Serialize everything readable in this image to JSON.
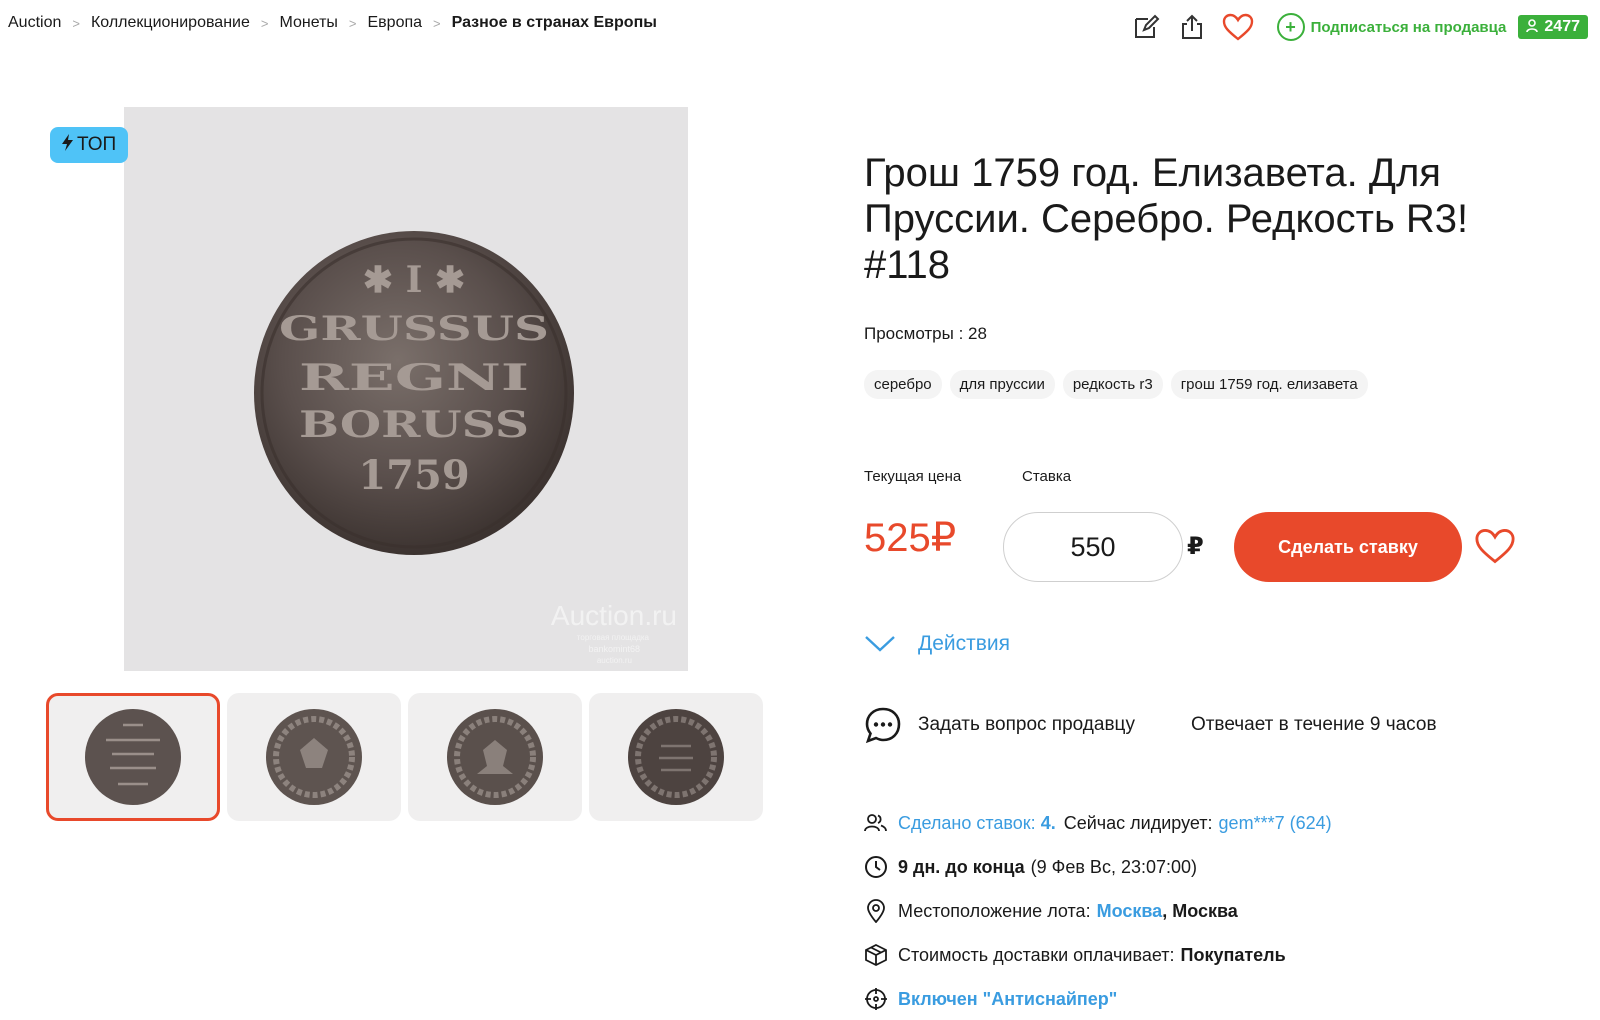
{
  "breadcrumb": [
    {
      "label": "Auction"
    },
    {
      "label": "Коллекционирование"
    },
    {
      "label": "Монеты"
    },
    {
      "label": "Европа"
    },
    {
      "label": "Разное в странах Европы"
    }
  ],
  "breadcrumb_separator": ">",
  "top_actions": {
    "subscribe_label": "Подписаться на продавца",
    "subscribe_symbol": "+",
    "seller_rating": "2477"
  },
  "badge": {
    "label": "ТОП"
  },
  "watermark": {
    "site": "Auction.ru",
    "line2": "торговая площадка",
    "line3": "bankomint68",
    "line4": "auction.ru"
  },
  "thumbnails": [
    {
      "icon": "coin-reverse-thumb-icon",
      "active": true
    },
    {
      "icon": "coin-obverse-thumb-icon",
      "active": false
    },
    {
      "icon": "coin-obverse2-thumb-icon",
      "active": false
    },
    {
      "icon": "coin-reverse2-thumb-icon",
      "active": false
    }
  ],
  "coin_inscription": {
    "line1": "✱ I ✱",
    "line2": "GRUSSUS",
    "line3": "REGNI",
    "line4": "BORUSS",
    "line5": "1759"
  },
  "lot": {
    "title": "Грош 1759 год. Елизавета. Для Пруссии. Серебро. Редкость R3! #118",
    "views": "Просмотры : 28",
    "tags": [
      "серебро",
      "для пруссии",
      "редкость r3",
      "грош 1759 год. елизавета"
    ]
  },
  "bidding": {
    "current_price_label": "Текущая цена",
    "bid_label": "Ставка",
    "current_price": "525₽",
    "bid_value": "550",
    "currency": "₽",
    "bid_button": "Сделать ставку"
  },
  "actions_label": "Действия",
  "ask": {
    "label": "Задать вопрос продавцу",
    "response_time": "Отвечает в течение 9 часов"
  },
  "info": {
    "bids_label": "Сделано ставок:",
    "bids_count": "4.",
    "leader_label": "Сейчас лидирует:",
    "leader": "gem***7 (624)",
    "time_left": "9 дн. до конца",
    "end_date": "(9 Фев Вс, 23:07:00)",
    "location_label": "Местоположение лота:",
    "location_city": "Москва",
    "location_region": ", Москва",
    "shipping_label": "Стоимость доставки оплачивает:",
    "shipping_payer": "Покупатель",
    "antisniper": "Включен \"Антиснайпер\""
  },
  "colors": {
    "accent_red": "#e8492b",
    "link_blue": "#3a9ce0",
    "green": "#3bb03b",
    "badge_blue": "#4fc3f7"
  }
}
